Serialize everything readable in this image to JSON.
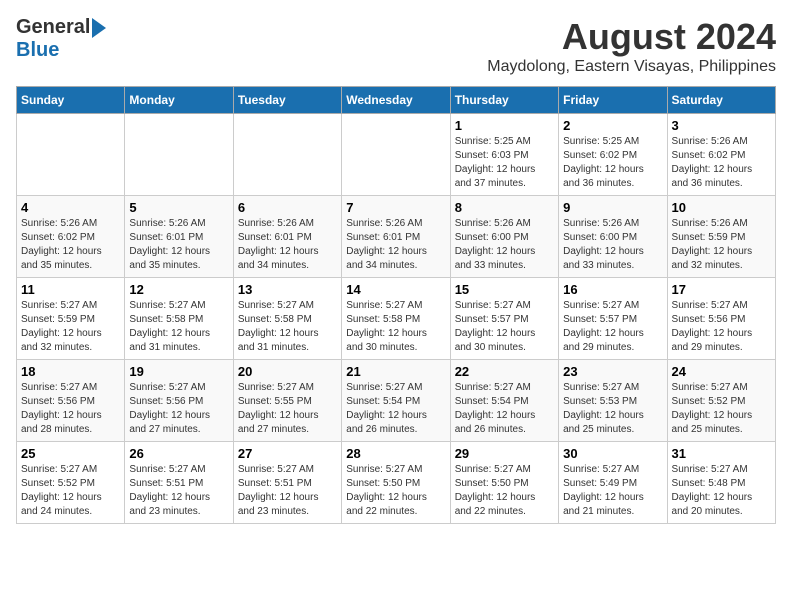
{
  "header": {
    "logo_general": "General",
    "logo_blue": "Blue",
    "main_title": "August 2024",
    "subtitle": "Maydolong, Eastern Visayas, Philippines"
  },
  "weekdays": [
    "Sunday",
    "Monday",
    "Tuesday",
    "Wednesday",
    "Thursday",
    "Friday",
    "Saturday"
  ],
  "weeks": [
    [
      {
        "day": "",
        "info": ""
      },
      {
        "day": "",
        "info": ""
      },
      {
        "day": "",
        "info": ""
      },
      {
        "day": "",
        "info": ""
      },
      {
        "day": "1",
        "info": "Sunrise: 5:25 AM\nSunset: 6:03 PM\nDaylight: 12 hours\nand 37 minutes."
      },
      {
        "day": "2",
        "info": "Sunrise: 5:25 AM\nSunset: 6:02 PM\nDaylight: 12 hours\nand 36 minutes."
      },
      {
        "day": "3",
        "info": "Sunrise: 5:26 AM\nSunset: 6:02 PM\nDaylight: 12 hours\nand 36 minutes."
      }
    ],
    [
      {
        "day": "4",
        "info": "Sunrise: 5:26 AM\nSunset: 6:02 PM\nDaylight: 12 hours\nand 35 minutes."
      },
      {
        "day": "5",
        "info": "Sunrise: 5:26 AM\nSunset: 6:01 PM\nDaylight: 12 hours\nand 35 minutes."
      },
      {
        "day": "6",
        "info": "Sunrise: 5:26 AM\nSunset: 6:01 PM\nDaylight: 12 hours\nand 34 minutes."
      },
      {
        "day": "7",
        "info": "Sunrise: 5:26 AM\nSunset: 6:01 PM\nDaylight: 12 hours\nand 34 minutes."
      },
      {
        "day": "8",
        "info": "Sunrise: 5:26 AM\nSunset: 6:00 PM\nDaylight: 12 hours\nand 33 minutes."
      },
      {
        "day": "9",
        "info": "Sunrise: 5:26 AM\nSunset: 6:00 PM\nDaylight: 12 hours\nand 33 minutes."
      },
      {
        "day": "10",
        "info": "Sunrise: 5:26 AM\nSunset: 5:59 PM\nDaylight: 12 hours\nand 32 minutes."
      }
    ],
    [
      {
        "day": "11",
        "info": "Sunrise: 5:27 AM\nSunset: 5:59 PM\nDaylight: 12 hours\nand 32 minutes."
      },
      {
        "day": "12",
        "info": "Sunrise: 5:27 AM\nSunset: 5:58 PM\nDaylight: 12 hours\nand 31 minutes."
      },
      {
        "day": "13",
        "info": "Sunrise: 5:27 AM\nSunset: 5:58 PM\nDaylight: 12 hours\nand 31 minutes."
      },
      {
        "day": "14",
        "info": "Sunrise: 5:27 AM\nSunset: 5:58 PM\nDaylight: 12 hours\nand 30 minutes."
      },
      {
        "day": "15",
        "info": "Sunrise: 5:27 AM\nSunset: 5:57 PM\nDaylight: 12 hours\nand 30 minutes."
      },
      {
        "day": "16",
        "info": "Sunrise: 5:27 AM\nSunset: 5:57 PM\nDaylight: 12 hours\nand 29 minutes."
      },
      {
        "day": "17",
        "info": "Sunrise: 5:27 AM\nSunset: 5:56 PM\nDaylight: 12 hours\nand 29 minutes."
      }
    ],
    [
      {
        "day": "18",
        "info": "Sunrise: 5:27 AM\nSunset: 5:56 PM\nDaylight: 12 hours\nand 28 minutes."
      },
      {
        "day": "19",
        "info": "Sunrise: 5:27 AM\nSunset: 5:56 PM\nDaylight: 12 hours\nand 27 minutes."
      },
      {
        "day": "20",
        "info": "Sunrise: 5:27 AM\nSunset: 5:55 PM\nDaylight: 12 hours\nand 27 minutes."
      },
      {
        "day": "21",
        "info": "Sunrise: 5:27 AM\nSunset: 5:54 PM\nDaylight: 12 hours\nand 26 minutes."
      },
      {
        "day": "22",
        "info": "Sunrise: 5:27 AM\nSunset: 5:54 PM\nDaylight: 12 hours\nand 26 minutes."
      },
      {
        "day": "23",
        "info": "Sunrise: 5:27 AM\nSunset: 5:53 PM\nDaylight: 12 hours\nand 25 minutes."
      },
      {
        "day": "24",
        "info": "Sunrise: 5:27 AM\nSunset: 5:52 PM\nDaylight: 12 hours\nand 25 minutes."
      }
    ],
    [
      {
        "day": "25",
        "info": "Sunrise: 5:27 AM\nSunset: 5:52 PM\nDaylight: 12 hours\nand 24 minutes."
      },
      {
        "day": "26",
        "info": "Sunrise: 5:27 AM\nSunset: 5:51 PM\nDaylight: 12 hours\nand 23 minutes."
      },
      {
        "day": "27",
        "info": "Sunrise: 5:27 AM\nSunset: 5:51 PM\nDaylight: 12 hours\nand 23 minutes."
      },
      {
        "day": "28",
        "info": "Sunrise: 5:27 AM\nSunset: 5:50 PM\nDaylight: 12 hours\nand 22 minutes."
      },
      {
        "day": "29",
        "info": "Sunrise: 5:27 AM\nSunset: 5:50 PM\nDaylight: 12 hours\nand 22 minutes."
      },
      {
        "day": "30",
        "info": "Sunrise: 5:27 AM\nSunset: 5:49 PM\nDaylight: 12 hours\nand 21 minutes."
      },
      {
        "day": "31",
        "info": "Sunrise: 5:27 AM\nSunset: 5:48 PM\nDaylight: 12 hours\nand 20 minutes."
      }
    ]
  ]
}
